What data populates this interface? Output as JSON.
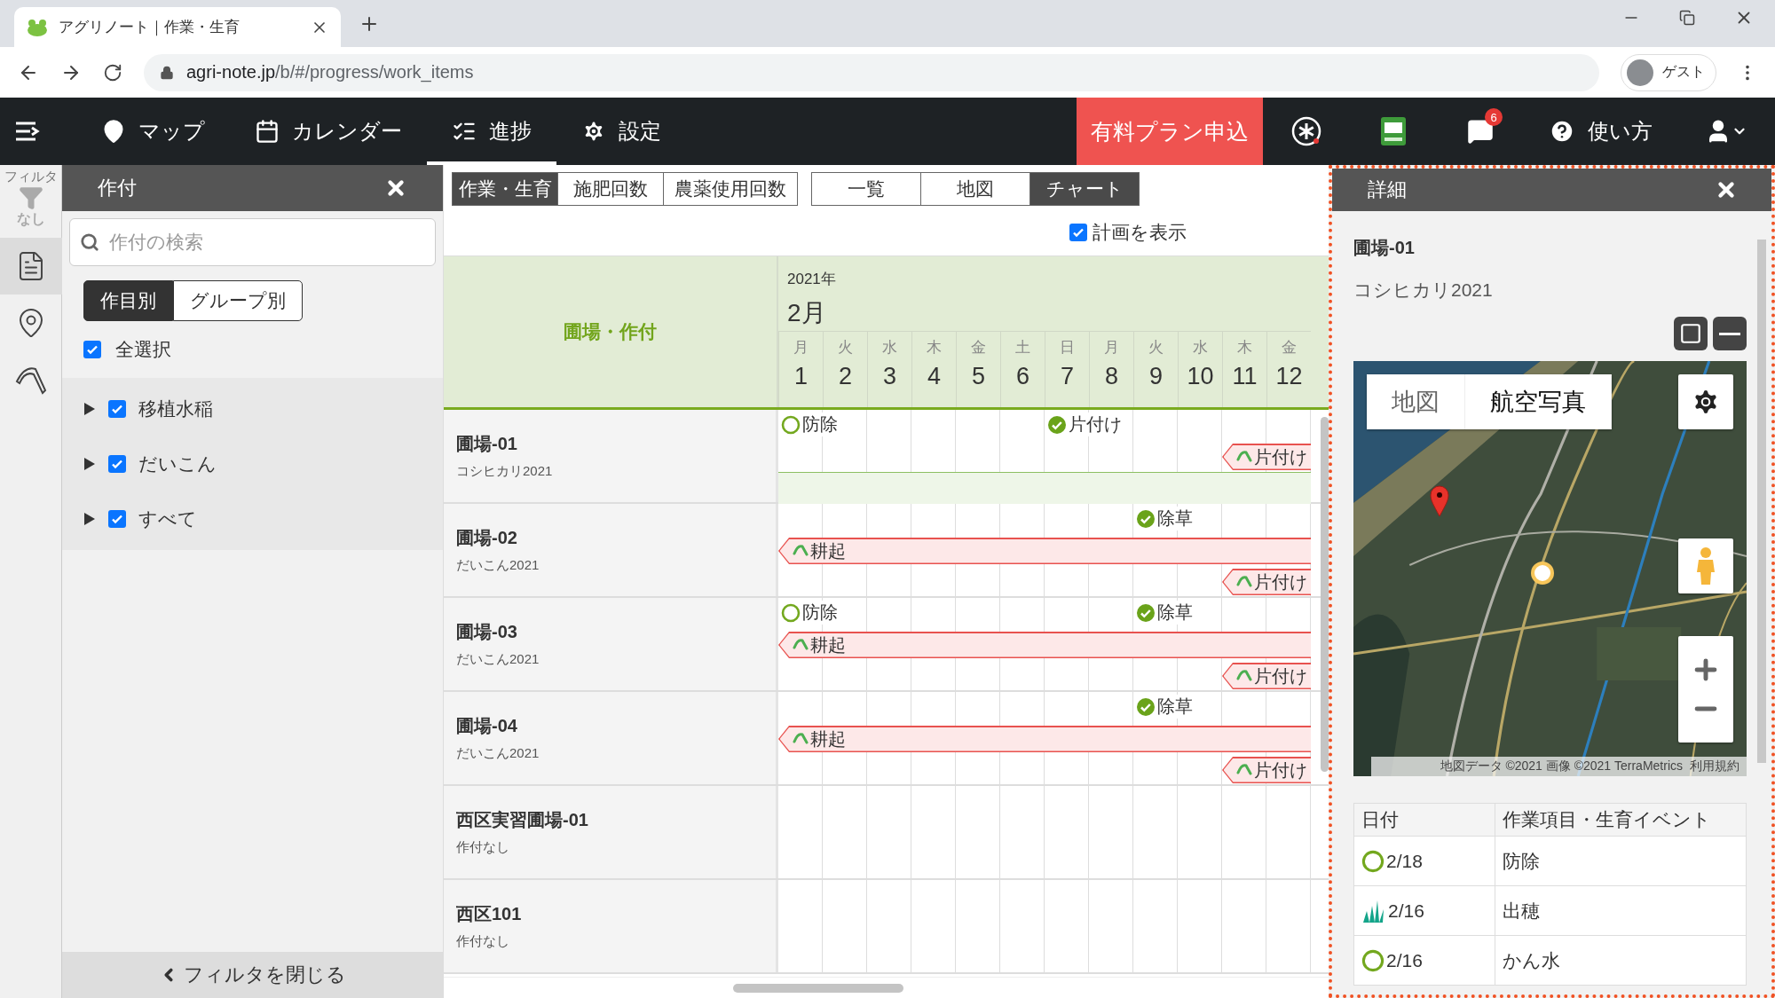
{
  "browser": {
    "tab_title": "アグリノート｜作業・生育",
    "url_domain": "agri-note.jp",
    "url_path": "/b/#/progress/work_items",
    "profile": "ゲスト"
  },
  "nav": {
    "items": [
      {
        "kind": "map",
        "label": "マップ",
        "selected": false
      },
      {
        "kind": "calendar",
        "label": "カレンダー",
        "selected": false
      },
      {
        "kind": "progress",
        "label": "進捗",
        "selected": true
      },
      {
        "kind": "settings",
        "label": "設定",
        "selected": false
      }
    ],
    "plan_button": "有料プラン申込",
    "notification_count": "6",
    "help": "使い方"
  },
  "rail": {
    "title": "フィルタ",
    "filter_state": "なし",
    "items": [
      {
        "kind": "document",
        "selected": true
      },
      {
        "kind": "pin",
        "selected": false
      },
      {
        "kind": "sickle",
        "selected": false
      }
    ]
  },
  "filter_panel": {
    "title": "作付",
    "search": {
      "placeholder": "作付の検索"
    },
    "modes": [
      {
        "label": "作目別",
        "selected": true
      },
      {
        "label": "グループ別",
        "selected": false
      }
    ],
    "select_all": {
      "label": "全選択",
      "checked": true
    },
    "groups": [
      {
        "label": "移植水稲",
        "checked": true,
        "expanded": false
      },
      {
        "label": "だいこん",
        "checked": true,
        "expanded": false
      },
      {
        "label": "すべて",
        "checked": true,
        "expanded": false
      }
    ],
    "footer": "フィルタを閉じる"
  },
  "main": {
    "view_tabs": [
      {
        "label": "作業・生育",
        "selected": true
      },
      {
        "label": "施肥回数",
        "selected": false
      },
      {
        "label": "農薬使用回数",
        "selected": false
      }
    ],
    "display_tabs": [
      {
        "label": "一覧",
        "selected": false
      },
      {
        "label": "地図",
        "selected": false
      },
      {
        "label": "チャート",
        "selected": true
      }
    ],
    "show_plan": {
      "label": "計画を表示",
      "checked": true
    }
  },
  "chart_header": {
    "field_column": "圃場・作付",
    "year": "2021年",
    "month": "2月",
    "days": [
      {
        "weekday": "月",
        "day": "1"
      },
      {
        "weekday": "火",
        "day": "2"
      },
      {
        "weekday": "水",
        "day": "3"
      },
      {
        "weekday": "木",
        "day": "4"
      },
      {
        "weekday": "金",
        "day": "5"
      },
      {
        "weekday": "土",
        "day": "6"
      },
      {
        "weekday": "日",
        "day": "7"
      },
      {
        "weekday": "月",
        "day": "8"
      },
      {
        "weekday": "火",
        "day": "9"
      },
      {
        "weekday": "水",
        "day": "10"
      },
      {
        "weekday": "木",
        "day": "11"
      },
      {
        "weekday": "金",
        "day": "12"
      }
    ]
  },
  "rows": [
    {
      "field": "圃場-01",
      "crop": "コシヒカリ2021",
      "lanes": [
        [
          {
            "kind": "planned",
            "label": "防除"
          },
          {
            "kind": "none"
          },
          {
            "kind": "none"
          },
          {
            "kind": "none"
          },
          {
            "kind": "none"
          },
          {
            "kind": "none"
          },
          {
            "kind": "done",
            "label": "片付け"
          }
        ],
        [
          {
            "kind": "none"
          },
          {
            "kind": "none"
          },
          {
            "kind": "none"
          },
          {
            "kind": "none"
          },
          {
            "kind": "none"
          },
          {
            "kind": "none"
          },
          {
            "kind": "none"
          },
          {
            "kind": "none"
          },
          {
            "kind": "none"
          },
          {
            "kind": "none"
          },
          {
            "kind": "bar",
            "label": "片付け"
          }
        ],
        [
          {
            "kind": "band"
          }
        ]
      ]
    },
    {
      "field": "圃場-02",
      "crop": "だいこん2021",
      "lanes": [
        [
          {
            "kind": "none"
          },
          {
            "kind": "none"
          },
          {
            "kind": "none"
          },
          {
            "kind": "none"
          },
          {
            "kind": "none"
          },
          {
            "kind": "none"
          },
          {
            "kind": "none"
          },
          {
            "kind": "none"
          },
          {
            "kind": "done",
            "label": "除草"
          }
        ],
        [
          {
            "kind": "bar",
            "label": "耕起"
          }
        ],
        [
          {
            "kind": "none"
          },
          {
            "kind": "none"
          },
          {
            "kind": "none"
          },
          {
            "kind": "none"
          },
          {
            "kind": "none"
          },
          {
            "kind": "none"
          },
          {
            "kind": "none"
          },
          {
            "kind": "none"
          },
          {
            "kind": "none"
          },
          {
            "kind": "none"
          },
          {
            "kind": "bar",
            "label": "片付け"
          }
        ]
      ]
    },
    {
      "field": "圃場-03",
      "crop": "だいこん2021",
      "lanes": [
        [
          {
            "kind": "planned",
            "label": "防除"
          },
          {
            "kind": "none"
          },
          {
            "kind": "none"
          },
          {
            "kind": "none"
          },
          {
            "kind": "none"
          },
          {
            "kind": "none"
          },
          {
            "kind": "none"
          },
          {
            "kind": "none"
          },
          {
            "kind": "done",
            "label": "除草"
          }
        ],
        [
          {
            "kind": "bar",
            "label": "耕起"
          }
        ],
        [
          {
            "kind": "none"
          },
          {
            "kind": "none"
          },
          {
            "kind": "none"
          },
          {
            "kind": "none"
          },
          {
            "kind": "none"
          },
          {
            "kind": "none"
          },
          {
            "kind": "none"
          },
          {
            "kind": "none"
          },
          {
            "kind": "none"
          },
          {
            "kind": "none"
          },
          {
            "kind": "bar",
            "label": "片付け"
          }
        ]
      ]
    },
    {
      "field": "圃場-04",
      "crop": "だいこん2021",
      "lanes": [
        [
          {
            "kind": "none"
          },
          {
            "kind": "none"
          },
          {
            "kind": "none"
          },
          {
            "kind": "none"
          },
          {
            "kind": "none"
          },
          {
            "kind": "none"
          },
          {
            "kind": "none"
          },
          {
            "kind": "none"
          },
          {
            "kind": "done",
            "label": "除草"
          }
        ],
        [
          {
            "kind": "bar",
            "label": "耕起"
          }
        ],
        [
          {
            "kind": "none"
          },
          {
            "kind": "none"
          },
          {
            "kind": "none"
          },
          {
            "kind": "none"
          },
          {
            "kind": "none"
          },
          {
            "kind": "none"
          },
          {
            "kind": "none"
          },
          {
            "kind": "none"
          },
          {
            "kind": "none"
          },
          {
            "kind": "none"
          },
          {
            "kind": "bar",
            "label": "片付け"
          }
        ]
      ]
    },
    {
      "field": "西区実習圃場-01",
      "crop": "作付なし"
    },
    {
      "field": "西区101",
      "crop": "作付なし"
    }
  ],
  "detail": {
    "title": "詳細",
    "field": "圃場-01",
    "crop": "コシヒカリ2021",
    "map": {
      "kind": "picture",
      "types": [
        {
          "label": "地図",
          "selected": false
        },
        {
          "label": "航空写真",
          "selected": true
        }
      ],
      "attribution": "地図データ ©2021 画像 ©2021 TerraMetrics",
      "terms": "利用規約"
    },
    "table": {
      "columns": [
        "日付",
        "作業項目・生育イベント"
      ],
      "rows": [
        {
          "kind": "planned",
          "date": "2/18",
          "item": "防除"
        },
        {
          "kind": "growth",
          "date": "2/16",
          "item": "出穂"
        },
        {
          "kind": "planned",
          "date": "2/16",
          "item": "かん水"
        }
      ]
    }
  }
}
